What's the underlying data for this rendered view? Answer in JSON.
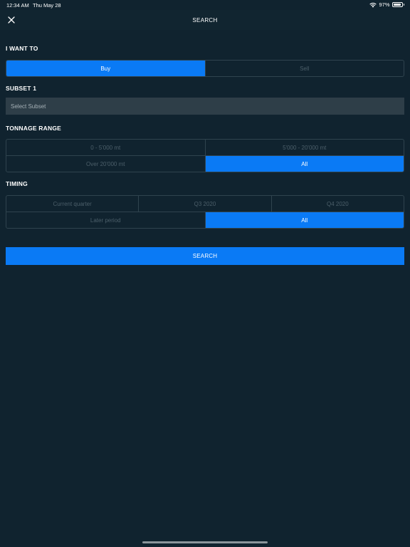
{
  "status_bar": {
    "time": "12:34 AM",
    "date": "Thu May 28",
    "battery": "97%",
    "battery_level": 0.97,
    "wifi_icon": "wifi-icon"
  },
  "nav": {
    "title": "SEARCH",
    "close_icon": "close-icon"
  },
  "intent": {
    "label": "I WANT TO",
    "options": [
      "Buy",
      "Sell"
    ],
    "selected": "Buy"
  },
  "subset": {
    "label": "SUBSET 1",
    "placeholder": "Select Subset"
  },
  "tonnage": {
    "label": "TONNAGE RANGE",
    "options": [
      "0 - 5'000 mt",
      "5'000 - 20'000 mt",
      "Over 20'000 mt",
      "All"
    ],
    "selected": "All"
  },
  "timing": {
    "label": "TIMING",
    "options": [
      "Current quarter",
      "Q3 2020",
      "Q4 2020",
      "Later period",
      "All"
    ],
    "selected": "All"
  },
  "search_button": {
    "label": "SEARCH"
  },
  "colors": {
    "background": "#10232f",
    "accent": "#0a7af5",
    "border": "#2f434e",
    "inactive_text": "#4c5f6a",
    "field_background": "#2e3e48"
  }
}
